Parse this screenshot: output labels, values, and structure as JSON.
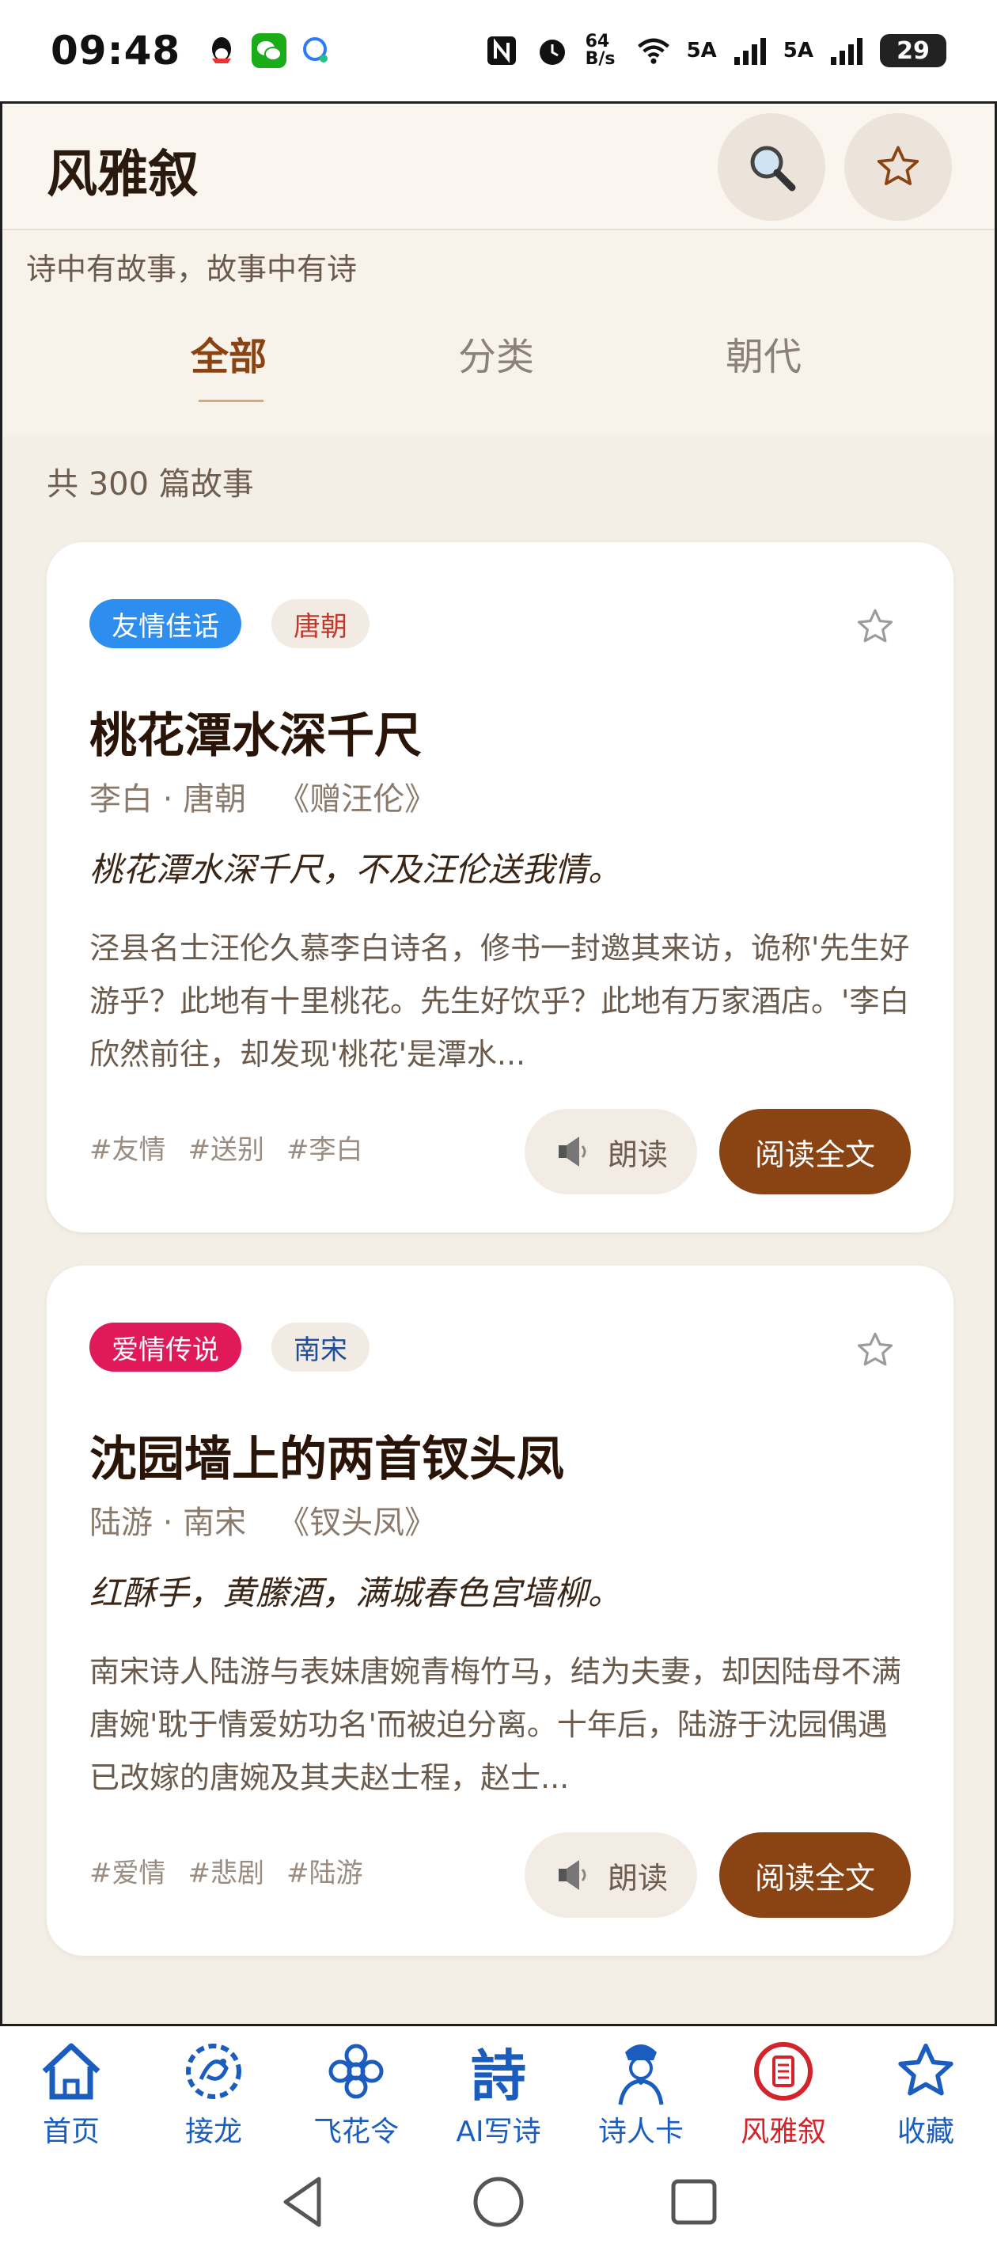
{
  "status": {
    "time": "09:48",
    "net_speed": "64 B/s",
    "sig1": "5A",
    "sig2": "5A",
    "battery": "29"
  },
  "header": {
    "title": "风雅叙"
  },
  "subtitle": "诗中有故事，故事中有诗",
  "tabs": [
    {
      "label": "全部"
    },
    {
      "label": "分类"
    },
    {
      "label": "朝代"
    }
  ],
  "count_text": "共 300 篇故事",
  "cards": [
    {
      "category": "友情佳话",
      "category_color": "#2d8ef0",
      "dynasty": "唐朝",
      "dynasty_color": "#c0392b",
      "title": "桃花潭水深千尺",
      "author": "李白 · 唐朝",
      "work": "《赠汪伦》",
      "verse": "桃花潭水深千尺，不及汪伦送我情。",
      "summary": "泾县名士汪伦久慕李白诗名，修书一封邀其来访，诡称'先生好游乎？此地有十里桃花。先生好饮乎？此地有万家酒店。'李白欣然前往，却发现'桃花'是潭水...",
      "hashtags": [
        "#友情",
        "#送别",
        "#李白"
      ],
      "read_label": "朗读",
      "full_label": "阅读全文"
    },
    {
      "category": "爱情传说",
      "category_color": "#e0195a",
      "dynasty": "南宋",
      "dynasty_color": "#1f4f9a",
      "title": "沈园墙上的两首钗头凤",
      "author": "陆游 · 南宋",
      "work": "《钗头凤》",
      "verse": "红酥手，黄縢酒，满城春色宫墙柳。",
      "summary": "南宋诗人陆游与表妹唐婉青梅竹马，结为夫妻，却因陆母不满唐婉'耽于情爱妨功名'而被迫分离。十年后，陆游于沈园偶遇已改嫁的唐婉及其夫赵士程，赵士...",
      "hashtags": [
        "#爱情",
        "#悲剧",
        "#陆游"
      ],
      "read_label": "朗读",
      "full_label": "阅读全文"
    }
  ],
  "nav": [
    {
      "label": "首页",
      "icon": "home-icon"
    },
    {
      "label": "接龙",
      "icon": "dragon-icon"
    },
    {
      "label": "飞花令",
      "icon": "flower-icon"
    },
    {
      "label": "AI写诗",
      "icon": "poem-char-icon",
      "char": "詩"
    },
    {
      "label": "诗人卡",
      "icon": "poet-icon"
    },
    {
      "label": "风雅叙",
      "icon": "scroll-icon"
    },
    {
      "label": "收藏",
      "icon": "star-icon"
    }
  ]
}
